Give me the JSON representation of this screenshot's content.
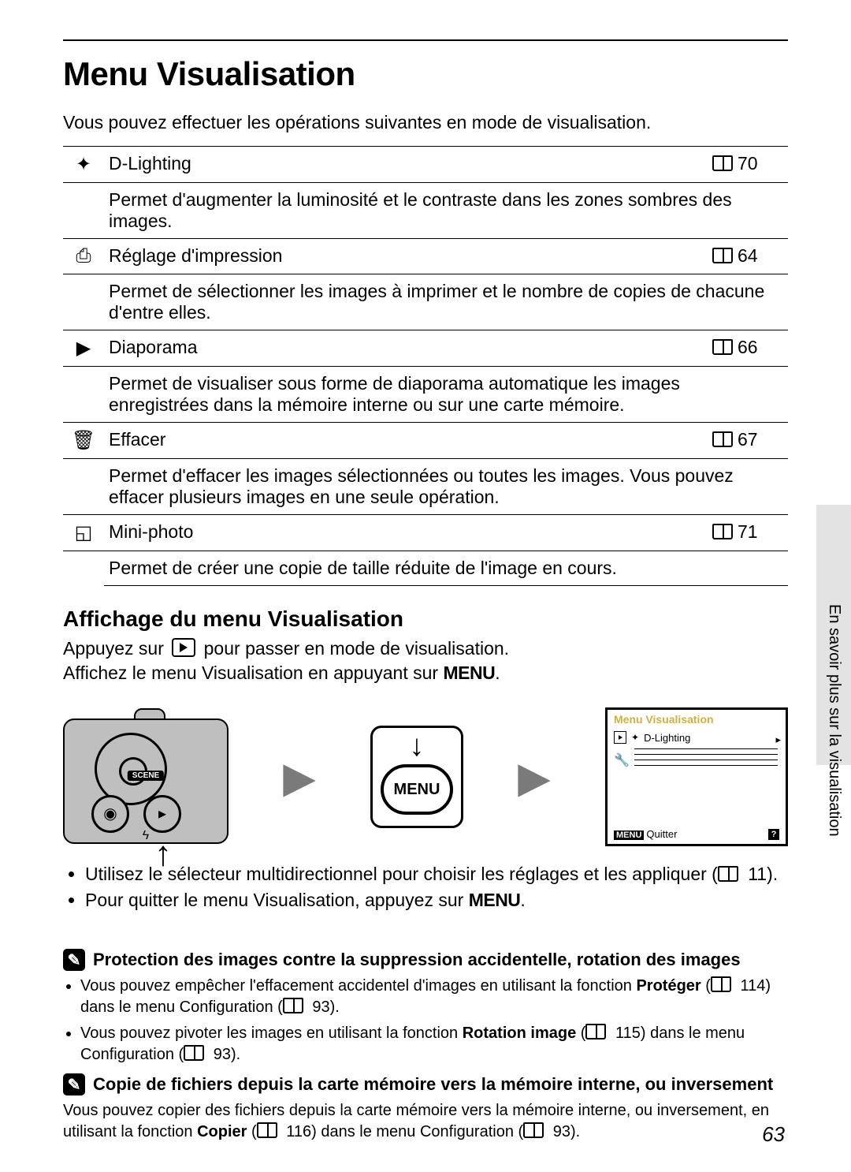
{
  "page": {
    "title": "Menu Visualisation",
    "intro": "Vous pouvez effectuer les opérations suivantes en mode de visualisation.",
    "sideTab": "En savoir plus sur la visualisation",
    "pageNumber": "63"
  },
  "menuItems": [
    {
      "icon": "✦",
      "name": "D-Lighting",
      "page": "70",
      "desc": "Permet d'augmenter la luminosité et le contraste dans les zones sombres des images."
    },
    {
      "icon": "⎙",
      "name": "Réglage d'impression",
      "page": "64",
      "desc": "Permet de sélectionner les images à imprimer et le nombre de copies de chacune d'entre elles."
    },
    {
      "icon": "▶",
      "name": "Diaporama",
      "page": "66",
      "desc": "Permet de visualiser sous forme de diaporama automatique les images enregistrées dans la mémoire interne ou sur une carte mémoire."
    },
    {
      "icon": "🗑",
      "name": "Effacer",
      "page": "67",
      "desc": "Permet d'effacer les images sélectionnées ou toutes les images. Vous pouvez effacer plusieurs images en une seule opération."
    },
    {
      "icon": "◱",
      "name": "Mini-photo",
      "page": "71",
      "desc": "Permet de créer une copie de taille réduite de l'image en cours."
    }
  ],
  "section2": {
    "heading": "Affichage du menu Visualisation",
    "line1a": "Appuyez sur ",
    "line1b": " pour passer en mode de visualisation.",
    "line2a": "Affichez le menu Visualisation en appuyant sur ",
    "menuWord": "MENU",
    "line2b": "."
  },
  "diagram": {
    "sceneLabel": "SCENE",
    "menuBtn": "MENU",
    "lcdTitle": "Menu Visualisation",
    "lcdItem": "D-Lighting",
    "lcdFooterMenu": "MENU",
    "lcdFooterQuit": "Quitter",
    "lcdHelp": "?"
  },
  "bullets": [
    {
      "pre": "Utilisez le sélecteur multidirectionnel pour choisir les réglages et les appliquer (",
      "page": "11",
      "post": ")."
    },
    {
      "pre": "Pour quitter le menu Visualisation, appuyez sur ",
      "menu": "MENU",
      "post": "."
    }
  ],
  "notes": [
    {
      "title": "Protection des images contre la suppression accidentelle, rotation des images",
      "items": [
        {
          "pre": "Vous pouvez empêcher l'effacement accidentel d'images en utilisant la fonction ",
          "bold": "Protéger",
          "mid": " (",
          "p1": "114",
          "mid2": ") dans le menu Configuration (",
          "p2": "93",
          "post": ")."
        },
        {
          "pre": "Vous pouvez pivoter les images en utilisant la fonction ",
          "bold": "Rotation image",
          "mid": " (",
          "p1": "115",
          "mid2": ") dans le menu Configuration (",
          "p2": "93",
          "post": ")."
        }
      ]
    },
    {
      "title": "Copie de fichiers depuis la carte mémoire vers la mémoire interne, ou inversement",
      "body": {
        "pre": "Vous pouvez copier des fichiers depuis la carte mémoire vers la mémoire interne, ou inversement, en utilisant la fonction ",
        "bold": "Copier",
        "mid": " (",
        "p1": "116",
        "mid2": ") dans le menu Configuration (",
        "p2": "93",
        "post": ")."
      }
    }
  ]
}
